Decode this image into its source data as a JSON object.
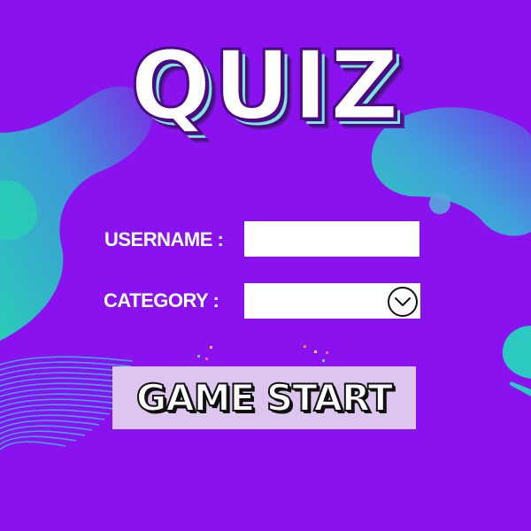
{
  "title": "QUIZ",
  "form": {
    "username_label": "USERNAME :",
    "username_value": "",
    "category_label": "CATEGORY :",
    "category_value": ""
  },
  "start_button": {
    "label": "GAME START"
  },
  "colors": {
    "background": "#8a12ee",
    "button_bg": "#dcc6ef",
    "title_shadow": "#7ee6d9"
  },
  "icons": {
    "dropdown": "chevron-down-circle"
  }
}
